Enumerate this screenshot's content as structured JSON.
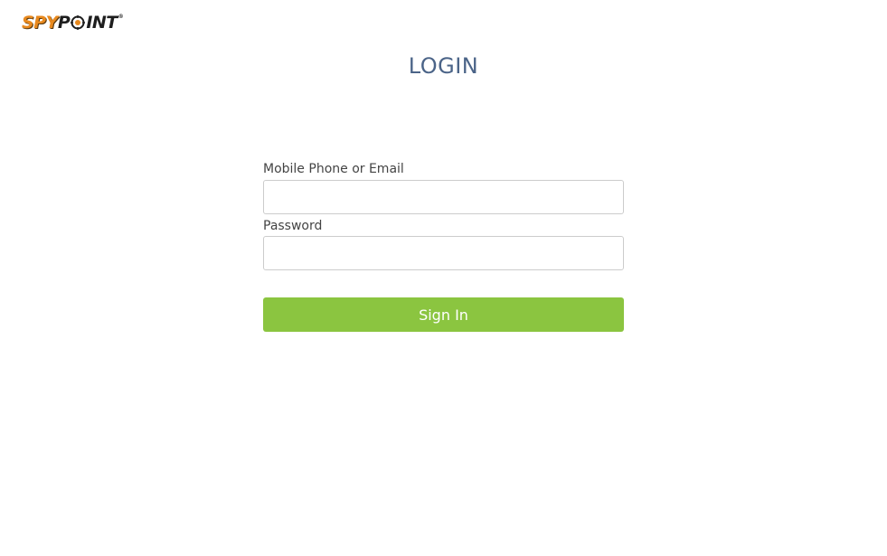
{
  "brand": {
    "logo_spy": "SPY",
    "logo_p": "P",
    "logo_int": "INT",
    "logo_reg": "®",
    "accent_color": "#e8891e"
  },
  "page": {
    "title": "LOGIN"
  },
  "form": {
    "email_label": "Mobile Phone or Email",
    "email_value": "",
    "password_label": "Password",
    "password_value": "",
    "signin_label": "Sign In",
    "signin_color": "#8bc540"
  },
  "icons": {
    "logo_target": "crosshair-target-icon"
  }
}
